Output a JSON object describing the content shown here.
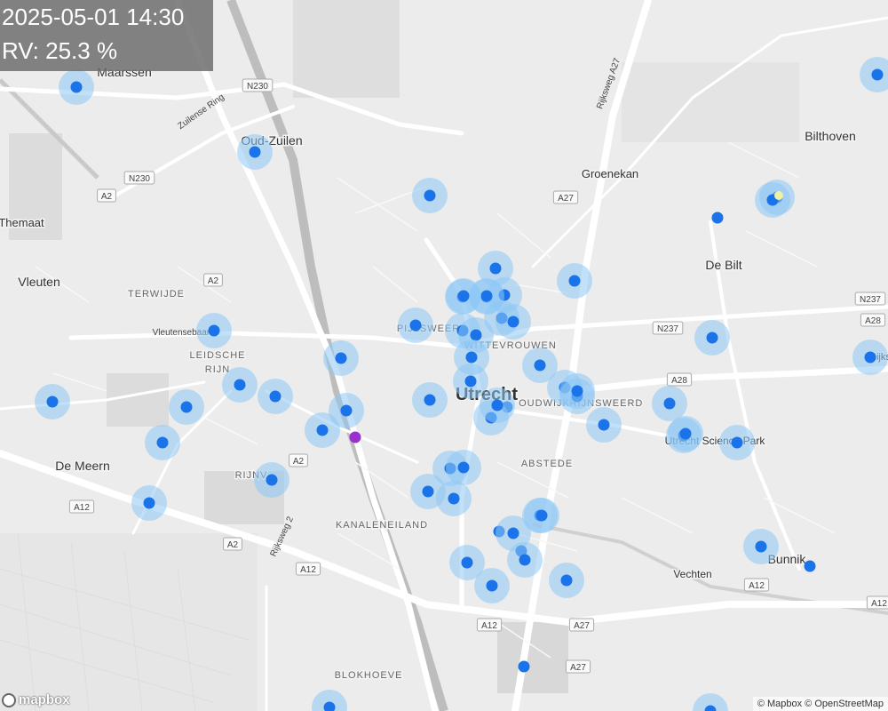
{
  "overlay": {
    "timestamp": "2025-05-01 14:30",
    "rv": "RV: 25.3 %"
  },
  "map": {
    "places_large": [
      {
        "name": "Utrecht"
      }
    ],
    "places": [
      {
        "name": "Maarssen"
      },
      {
        "name": "Oud-Zuilen"
      },
      {
        "name": "Bilthoven"
      },
      {
        "name": "Groenekan"
      },
      {
        "name": "De Bilt"
      },
      {
        "name": "Vleuten"
      },
      {
        "name": "De Meern"
      },
      {
        "name": "Bunnik"
      },
      {
        "name": "Vechten"
      },
      {
        "name": "Themaat"
      },
      {
        "name": "Utrecht Science Park"
      },
      {
        "name": "Rijkswe"
      }
    ],
    "districts": [
      {
        "name": "TERWIJDE"
      },
      {
        "name": "LEIDSCHE"
      },
      {
        "name": "RIJN"
      },
      {
        "name": "PIJLSWEERD"
      },
      {
        "name": "WITTEVROUWEN"
      },
      {
        "name": "OUDWIJK"
      },
      {
        "name": "RIJNSWEERD"
      },
      {
        "name": "ABSTEDE"
      },
      {
        "name": "KANALENEILAND"
      },
      {
        "name": "BLOKHOEVE"
      },
      {
        "name": "RIJNV"
      }
    ],
    "streets": [
      {
        "name": "Zuilense Ring"
      },
      {
        "name": "Vleutensebaan"
      },
      {
        "name": "Rijksweg A27"
      },
      {
        "name": "Rijksweg 2"
      }
    ],
    "shields": [
      {
        "name": "N230"
      },
      {
        "name": "N230"
      },
      {
        "name": "A2"
      },
      {
        "name": "A2"
      },
      {
        "name": "A2"
      },
      {
        "name": "A2"
      },
      {
        "name": "A12"
      },
      {
        "name": "A12"
      },
      {
        "name": "A12"
      },
      {
        "name": "A12"
      },
      {
        "name": "A12"
      },
      {
        "name": "A27"
      },
      {
        "name": "A27"
      },
      {
        "name": "A27"
      },
      {
        "name": "A28"
      },
      {
        "name": "A28"
      },
      {
        "name": "N237"
      },
      {
        "name": "N237"
      }
    ],
    "colors": {
      "background": "#ececec",
      "road": "#ffffff",
      "sensor_dot": "#1a73e8",
      "sensor_halo": "#8ec8f5",
      "outlier_dot": "#9b30d0",
      "outlier_halo": "#f0f0a0",
      "overlay_bg": "#6e6e6e"
    },
    "sensors": [
      {
        "id": 1,
        "halo": true
      },
      {
        "id": 2,
        "halo": true
      },
      {
        "id": 3,
        "halo": true
      },
      {
        "id": 4,
        "halo": true
      },
      {
        "id": 5,
        "halo": false
      },
      {
        "id": 6,
        "halo": true
      },
      {
        "id": 7,
        "halo": true
      },
      {
        "id": 8,
        "halo": true
      },
      {
        "id": 9,
        "halo": true
      },
      {
        "id": 10,
        "halo": true
      },
      {
        "id": 11,
        "halo": true
      },
      {
        "id": 12,
        "halo": true
      },
      {
        "id": 13,
        "halo": true
      },
      {
        "id": 14,
        "halo": true
      },
      {
        "id": 15,
        "halo": true
      },
      {
        "id": 16,
        "halo": true
      },
      {
        "id": 17,
        "halo": true
      },
      {
        "id": 18,
        "halo": true
      },
      {
        "id": 19,
        "halo": true
      },
      {
        "id": 20,
        "halo": true
      },
      {
        "id": 21,
        "halo": true
      },
      {
        "id": 22,
        "halo": true
      },
      {
        "id": 23,
        "halo": true
      },
      {
        "id": 24,
        "halo": true
      },
      {
        "id": 25,
        "halo": true
      },
      {
        "id": 26,
        "halo": true
      },
      {
        "id": 27,
        "halo": true
      },
      {
        "id": 28,
        "halo": true
      },
      {
        "id": 29,
        "halo": true
      },
      {
        "id": 30,
        "halo": false
      },
      {
        "id": 31,
        "halo": true
      },
      {
        "id": 32,
        "halo": true
      },
      {
        "id": 33,
        "halo": true
      },
      {
        "id": 34,
        "halo": true
      },
      {
        "id": 35,
        "halo": true
      },
      {
        "id": 36,
        "halo": true
      },
      {
        "id": 37,
        "halo": true
      },
      {
        "id": 38,
        "halo": true
      },
      {
        "id": 39,
        "halo": true
      },
      {
        "id": 40,
        "halo": true
      },
      {
        "id": 41,
        "halo": true
      },
      {
        "id": 42,
        "halo": true
      },
      {
        "id": 43,
        "halo": true
      },
      {
        "id": 44,
        "halo": false
      },
      {
        "id": 45,
        "halo": true
      },
      {
        "id": 46,
        "halo": false
      },
      {
        "id": 47,
        "halo": true
      },
      {
        "id": 48,
        "halo": true
      },
      {
        "id": 49,
        "halo": true
      },
      {
        "id": 50,
        "halo": true
      },
      {
        "id": 51,
        "halo": true
      },
      {
        "id": 52,
        "halo": false
      },
      {
        "id": 53,
        "halo": true
      },
      {
        "id": 54,
        "halo": true
      },
      {
        "id": 55,
        "halo": false
      },
      {
        "id": 56,
        "halo": true
      },
      {
        "id": 57,
        "halo": true
      },
      {
        "id": 58,
        "halo": true
      },
      {
        "id": 59,
        "halo": true
      },
      {
        "id": 60,
        "halo": true
      },
      {
        "id": 61,
        "halo": true
      },
      {
        "id": 62,
        "halo": true
      },
      {
        "id": 63,
        "halo": true
      },
      {
        "id": 64,
        "halo": true
      },
      {
        "id": 65,
        "halo": true
      }
    ],
    "outlier": {
      "id": "outlier"
    }
  },
  "branding": {
    "logo": "mapbox",
    "attribution": "© Mapbox © OpenStreetMap"
  }
}
